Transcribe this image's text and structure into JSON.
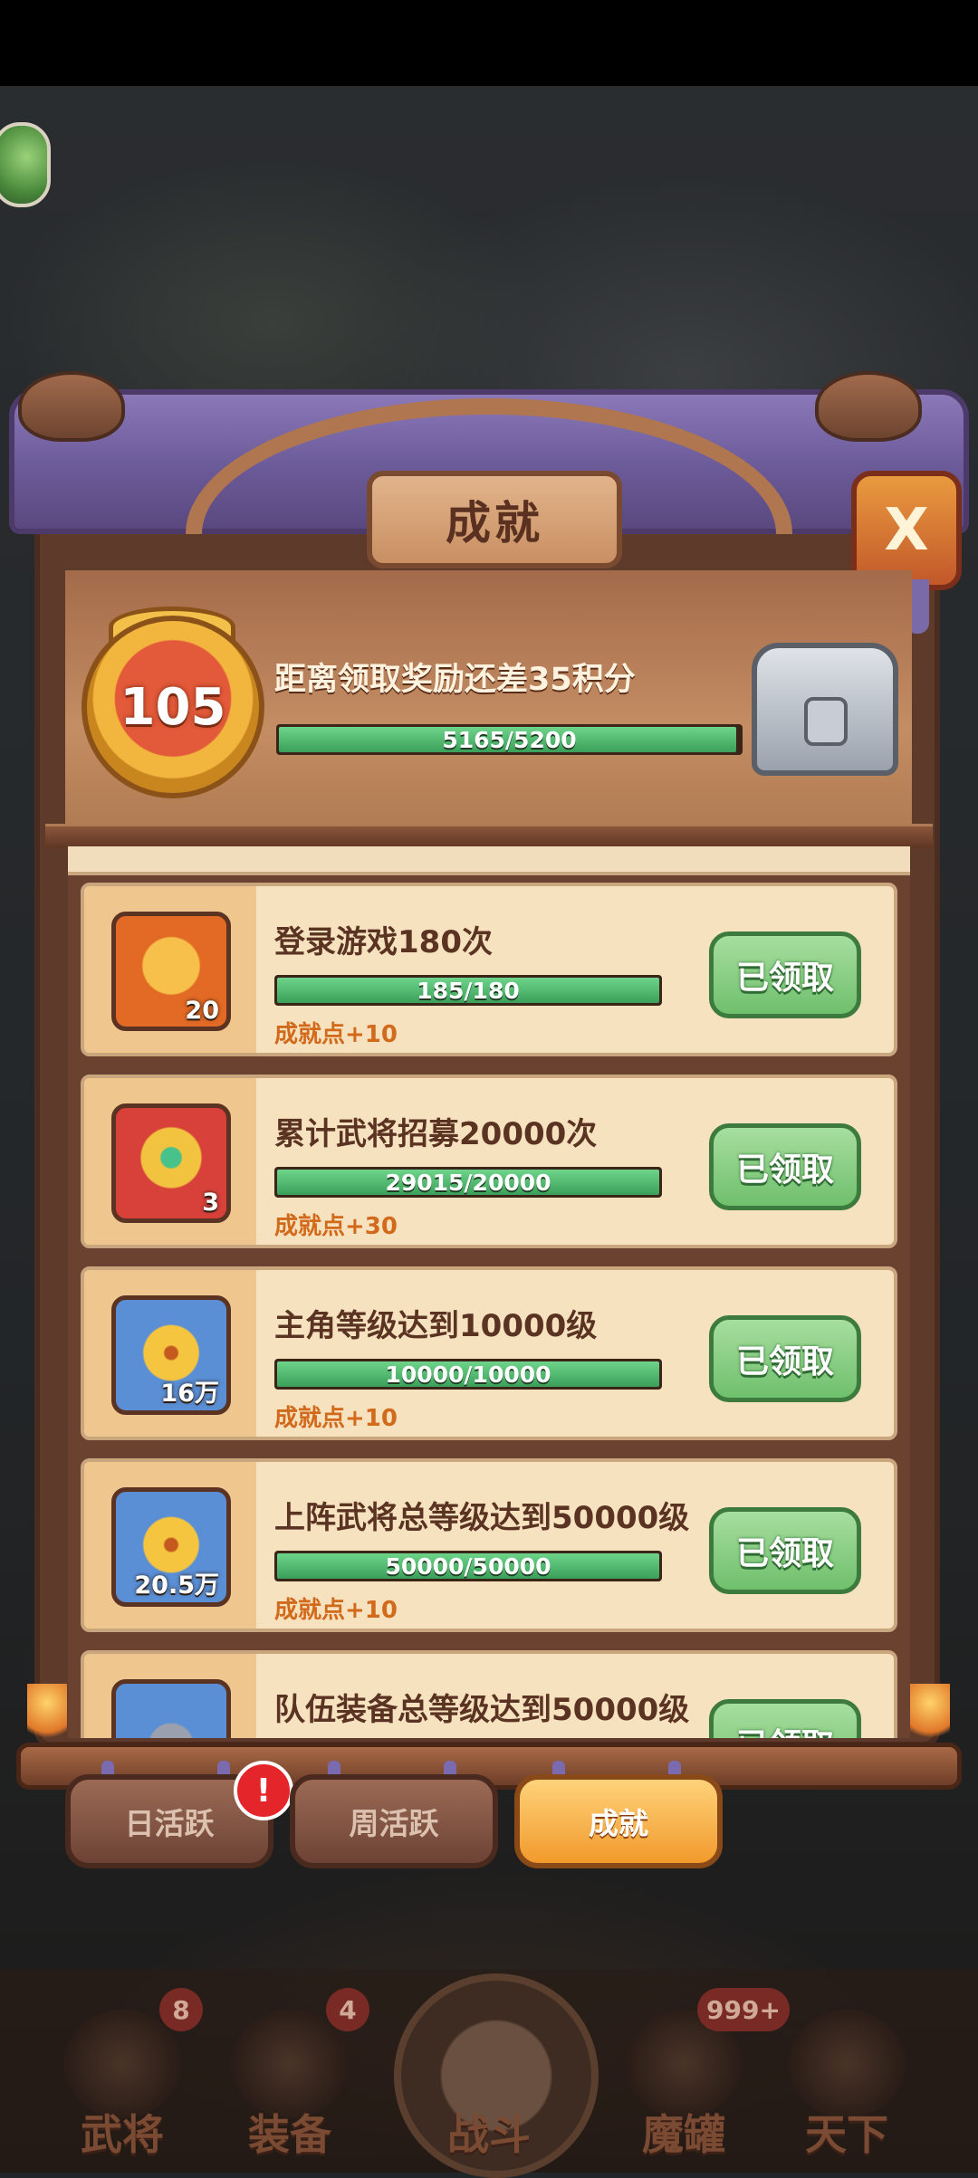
{
  "panel": {
    "title": "成就",
    "close_label": "X"
  },
  "header": {
    "level": "105",
    "message": "距离领取奖励还差35积分",
    "progress_text": "5165/5200",
    "progress_fraction": 0.993
  },
  "achievements": [
    {
      "icon": "gold-ingot-icon",
      "icon_qty": "20",
      "title": "登录游戏180次",
      "progress_text": "185/180",
      "progress_fraction": 1.0,
      "points": "成就点+10",
      "button": "已领取"
    },
    {
      "icon": "recruit-scroll-icon",
      "icon_qty": "3",
      "title": "累计武将招募20000次",
      "progress_text": "29015/20000",
      "progress_fraction": 1.0,
      "points": "成就点+30",
      "button": "已领取"
    },
    {
      "icon": "copper-coin-icon",
      "icon_qty": "16万",
      "title": "主角等级达到10000级",
      "progress_text": "10000/10000",
      "progress_fraction": 1.0,
      "points": "成就点+10",
      "button": "已领取"
    },
    {
      "icon": "copper-coin-icon",
      "icon_qty": "20.5万",
      "title": "上阵武将总等级达到50000级",
      "progress_text": "50000/50000",
      "progress_fraction": 1.0,
      "points": "成就点+10",
      "button": "已领取"
    },
    {
      "icon": "ore-stone-icon",
      "icon_qty": "",
      "title": "队伍装备总等级达到50000级",
      "progress_text": "",
      "progress_fraction": 1.0,
      "points": "",
      "button": "已领取"
    }
  ],
  "tabs": {
    "daily": "日活跃",
    "weekly": "周活跃",
    "achievement": "成就",
    "daily_alert": "!"
  },
  "bottom_nav": {
    "generals": "武将",
    "generals_badge": "8",
    "equipment": "装备",
    "equipment_badge": "4",
    "battle": "战斗",
    "magic_jar": "魔罐",
    "magic_jar_badge": "999+",
    "world": "天下"
  },
  "colors": {
    "progress_fill": "#3aa05a",
    "claimed_button": "#6fc06d",
    "points_text": "#d26a1c",
    "active_tab": "#f19a2c"
  }
}
